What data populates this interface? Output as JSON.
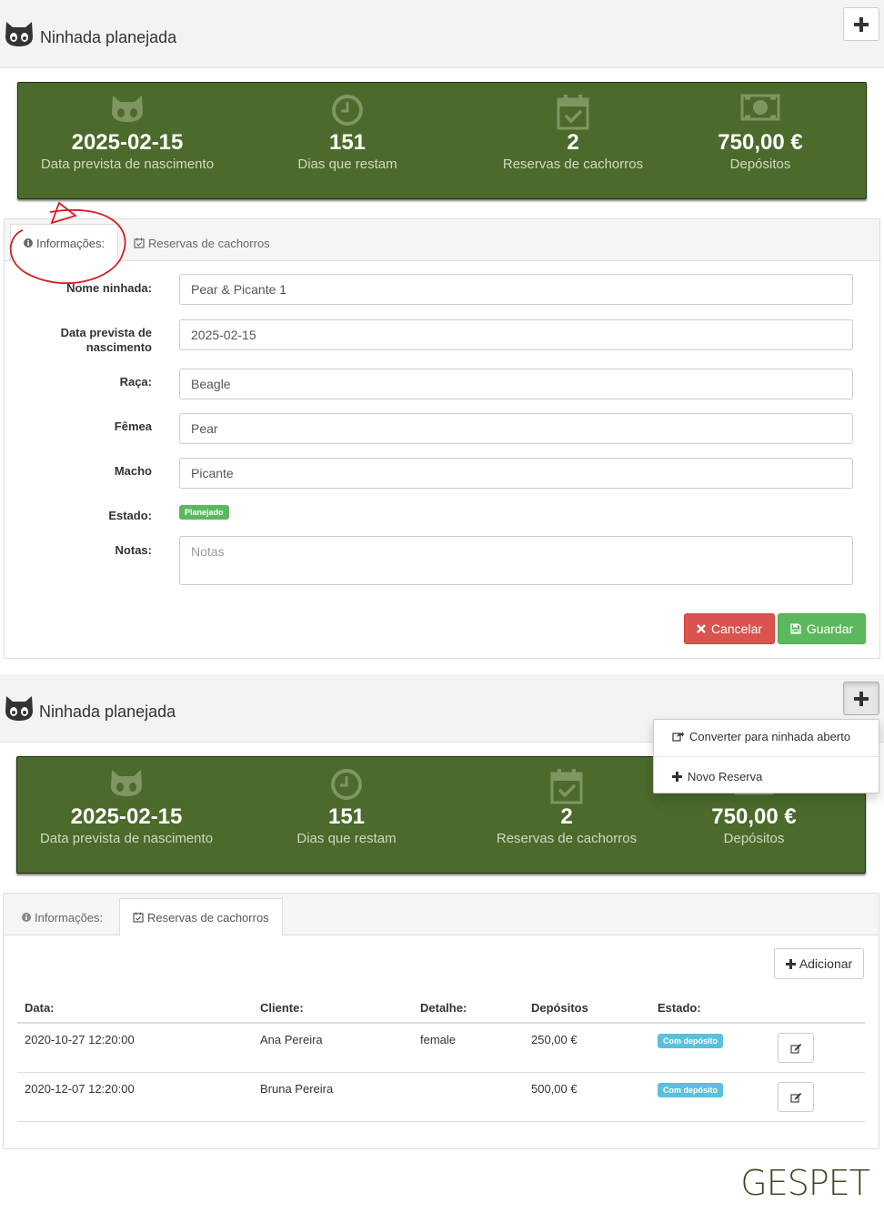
{
  "page": {
    "title": "Ninhada planejada"
  },
  "stats": [
    {
      "icon": "cat-icon",
      "value": "2025-02-15",
      "label": "Data prevista de nascimento"
    },
    {
      "icon": "clock-icon",
      "value": "151",
      "label": "Dias que restam"
    },
    {
      "icon": "calendar-check-icon",
      "value": "2",
      "label": "Reservas de cachorros"
    },
    {
      "icon": "money-icon",
      "value": "750,00 €",
      "label": "Depósitos"
    }
  ],
  "tabs": {
    "info": "Informações:",
    "reservations": "Reservas de cachorros"
  },
  "form": {
    "name_label": "Nome ninhada:",
    "name_value": "Pear & Picante 1",
    "date_label_1": "Data prevista de",
    "date_label_2": "nascimento",
    "date_value": "2025-02-15",
    "breed_label": "Raça:",
    "breed_value": "Beagle",
    "female_label": "Fêmea",
    "female_value": "Pear",
    "male_label": "Macho",
    "male_value": "Picante",
    "state_label": "Estado:",
    "state_badge": "Planejado",
    "notes_label": "Notas:",
    "notes_placeholder": "Notas",
    "cancel": "Cancelar",
    "save": "Guardar"
  },
  "dropdown": {
    "convert": "Converter para ninhada aberto",
    "new_reservation": "Novo Reserva"
  },
  "reservations": {
    "add": "Adicionar",
    "headers": [
      "Data:",
      "Cliente:",
      "Detalhe:",
      "Depósitos",
      "Estado:"
    ],
    "rows": [
      {
        "date": "2020-10-27 12:20:00",
        "client": "Ana Pereira",
        "detail": "female",
        "deposit": "250,00 €",
        "state": "Com depósito"
      },
      {
        "date": "2020-12-07 12:20:00",
        "client": "Bruna Pereira",
        "detail": "",
        "deposit": "500,00 €",
        "state": "Com depósito"
      }
    ]
  },
  "brand": "GESPET",
  "colors": {
    "stats_bg": "#4b6a2c",
    "cancel": "#d9534f",
    "save": "#5cb85c",
    "badge_planned": "#5cb85c",
    "badge_deposit": "#5bc0de"
  }
}
